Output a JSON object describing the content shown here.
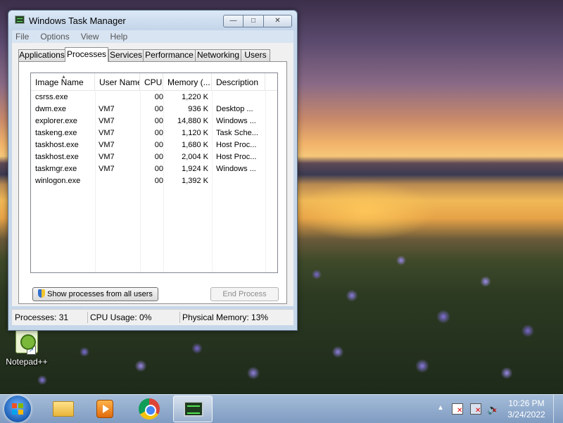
{
  "window": {
    "title": "Windows Task Manager",
    "buttons": {
      "minimize": "—",
      "maximize": "□",
      "close": "✕"
    }
  },
  "menu": [
    "File",
    "Options",
    "View",
    "Help"
  ],
  "tabs": [
    "Applications",
    "Processes",
    "Services",
    "Performance",
    "Networking",
    "Users"
  ],
  "active_tab": "Processes",
  "process_list": {
    "columns": [
      "Image Name",
      "User Name",
      "CPU",
      "Memory (...",
      "Description"
    ],
    "sort_column": "Image Name",
    "rows": [
      {
        "name": "csrss.exe",
        "user": "",
        "cpu": "00",
        "mem": "1,220 K",
        "desc": ""
      },
      {
        "name": "dwm.exe",
        "user": "VM7",
        "cpu": "00",
        "mem": "936 K",
        "desc": "Desktop ..."
      },
      {
        "name": "explorer.exe",
        "user": "VM7",
        "cpu": "00",
        "mem": "14,880 K",
        "desc": "Windows ..."
      },
      {
        "name": "taskeng.exe",
        "user": "VM7",
        "cpu": "00",
        "mem": "1,120 K",
        "desc": "Task Sche..."
      },
      {
        "name": "taskhost.exe",
        "user": "VM7",
        "cpu": "00",
        "mem": "1,680 K",
        "desc": "Host Proc..."
      },
      {
        "name": "taskhost.exe",
        "user": "VM7",
        "cpu": "00",
        "mem": "2,004 K",
        "desc": "Host Proc..."
      },
      {
        "name": "taskmgr.exe",
        "user": "VM7",
        "cpu": "00",
        "mem": "1,924 K",
        "desc": "Windows ..."
      },
      {
        "name": "winlogon.exe",
        "user": "",
        "cpu": "00",
        "mem": "1,392 K",
        "desc": ""
      }
    ]
  },
  "buttons": {
    "show_all": "Show processes from all users",
    "end_process": "End Process"
  },
  "status": {
    "processes": "Processes: 31",
    "cpu": "CPU Usage: 0%",
    "memory": "Physical Memory: 13%"
  },
  "desktop_icons": [
    {
      "label": "Notepad++",
      "icon": "notepadpp-icon"
    }
  ],
  "taskbar": {
    "pinned": [
      "windows-explorer-icon",
      "media-player-icon",
      "chrome-icon",
      "task-manager-icon"
    ],
    "time": "10:26 PM",
    "date": "3/24/2022"
  }
}
